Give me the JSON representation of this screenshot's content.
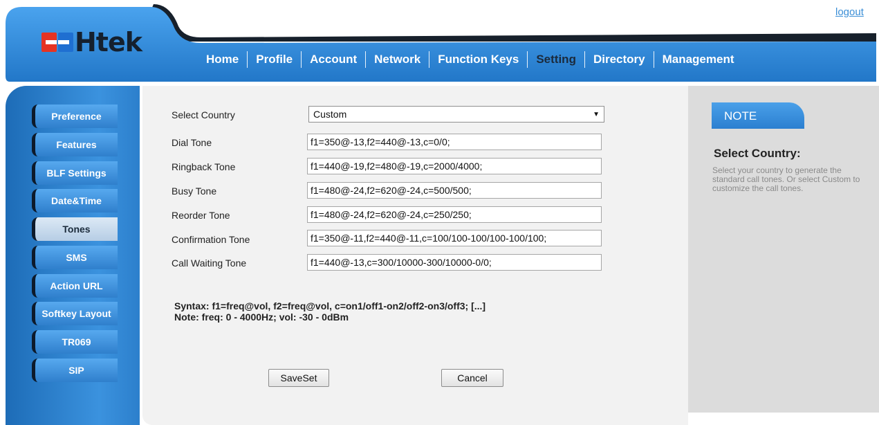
{
  "header": {
    "logout_label": "logout",
    "logo_text": "Htek",
    "nav": [
      {
        "label": "Home"
      },
      {
        "label": "Profile"
      },
      {
        "label": "Account"
      },
      {
        "label": "Network"
      },
      {
        "label": "Function Keys"
      },
      {
        "label": "Setting",
        "active": true
      },
      {
        "label": "Directory"
      },
      {
        "label": "Management"
      }
    ]
  },
  "sidebar": {
    "items": [
      {
        "label": "Preference"
      },
      {
        "label": "Features"
      },
      {
        "label": "BLF Settings"
      },
      {
        "label": "Date&Time"
      },
      {
        "label": "Tones",
        "active": true
      },
      {
        "label": "SMS"
      },
      {
        "label": "Action URL"
      },
      {
        "label": "Softkey Layout"
      },
      {
        "label": "TR069"
      },
      {
        "label": "SIP"
      }
    ]
  },
  "form": {
    "country": {
      "label": "Select Country",
      "value": "Custom"
    },
    "rows": [
      {
        "label": "Dial Tone",
        "value": "f1=350@-13,f2=440@-13,c=0/0;"
      },
      {
        "label": "Ringback Tone",
        "value": "f1=440@-19,f2=480@-19,c=2000/4000;"
      },
      {
        "label": "Busy Tone",
        "value": "f1=480@-24,f2=620@-24,c=500/500;"
      },
      {
        "label": "Reorder Tone",
        "value": "f1=480@-24,f2=620@-24,c=250/250;"
      },
      {
        "label": "Confirmation Tone",
        "value": "f1=350@-11,f2=440@-11,c=100/100-100/100-100/100;"
      },
      {
        "label": "Call Waiting Tone",
        "value": "f1=440@-13,c=300/10000-300/10000-0/0;"
      }
    ],
    "syntax_line1": "Syntax: f1=freq@vol, f2=freq@vol, c=on1/off1-on2/off2-on3/off3; [...]",
    "syntax_line2": "Note: freq: 0 - 4000Hz; vol: -30 - 0dBm",
    "save_label": "SaveSet",
    "cancel_label": "Cancel"
  },
  "note": {
    "tab_label": "NOTE",
    "title": "Select Country:",
    "description": "Select your country to generate the standard call tones. Or select Custom to customize the call tones."
  },
  "colors": {
    "nav_bar": "#2a84d4",
    "header_dark": "#17202b",
    "sidebar": "#3b92de",
    "link": "#3a8ed6"
  }
}
